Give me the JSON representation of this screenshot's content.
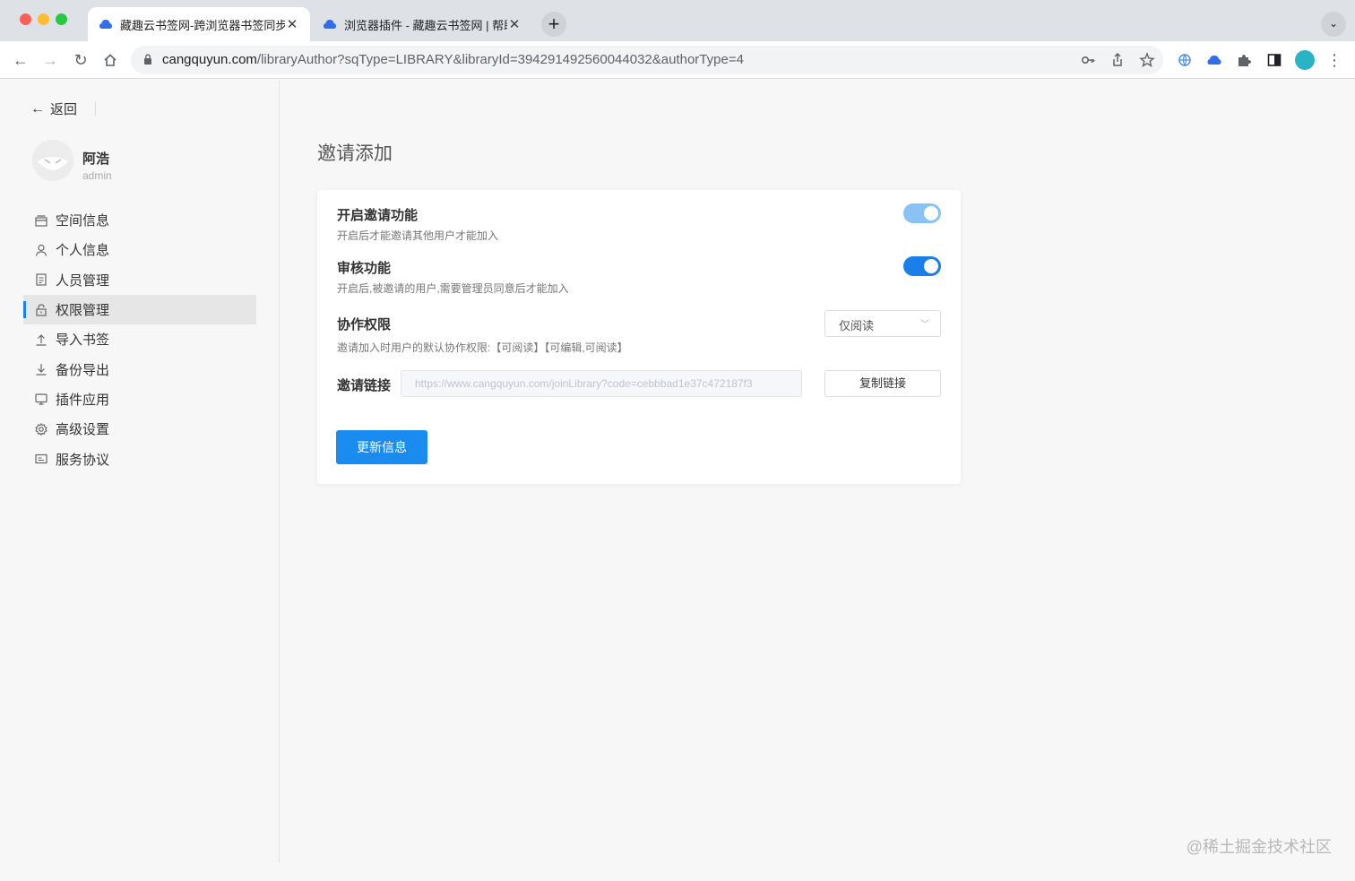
{
  "browser": {
    "tabs": [
      {
        "title": "藏趣云书签网-跨浏览器书签同步",
        "active": true
      },
      {
        "title": "浏览器插件 - 藏趣云书签网 | 帮助",
        "active": false
      }
    ],
    "url_host": "cangquyun.com",
    "url_path": "/libraryAuthor?sqType=LIBRARY&libraryId=394291492560044032&authorType=4"
  },
  "sidebar": {
    "back_label": "返回",
    "user": {
      "name": "阿浩",
      "role": "admin"
    },
    "items": [
      {
        "label": "空间信息",
        "icon": "space-icon",
        "active": false
      },
      {
        "label": "个人信息",
        "icon": "user-icon",
        "active": false
      },
      {
        "label": "人员管理",
        "icon": "document-icon",
        "active": false
      },
      {
        "label": "权限管理",
        "icon": "lock-icon",
        "active": true
      },
      {
        "label": "导入书签",
        "icon": "upload-icon",
        "active": false
      },
      {
        "label": "备份导出",
        "icon": "download-icon",
        "active": false
      },
      {
        "label": "插件应用",
        "icon": "monitor-icon",
        "active": false
      },
      {
        "label": "高级设置",
        "icon": "gear-icon",
        "active": false
      },
      {
        "label": "服务协议",
        "icon": "card-icon",
        "active": false
      }
    ]
  },
  "main": {
    "title": "邀请添加",
    "invite_toggle": {
      "title": "开启邀请功能",
      "desc": "开启后才能邀请其他用户才能加入",
      "on": true
    },
    "review_toggle": {
      "title": "审核功能",
      "desc": "开启后,被邀请的用户,需要管理员同意后才能加入",
      "on": true
    },
    "permission": {
      "title": "协作权限",
      "selected": "仅阅读",
      "desc": "邀请加入时用户的默认协作权限:【可阅读】【可编辑,可阅读】"
    },
    "invite_link": {
      "label": "邀请链接",
      "value": "https://www.cangquyun.com/joinLibrary?code=cebbbad1e37c472187f3",
      "copy_label": "复制链接"
    },
    "submit_label": "更新信息"
  },
  "watermark": "@稀土掘金技术社区",
  "colors": {
    "accent": "#1a8cf0",
    "toggle_light": "#89c2f5",
    "toggle_on": "#1a7fe8"
  }
}
